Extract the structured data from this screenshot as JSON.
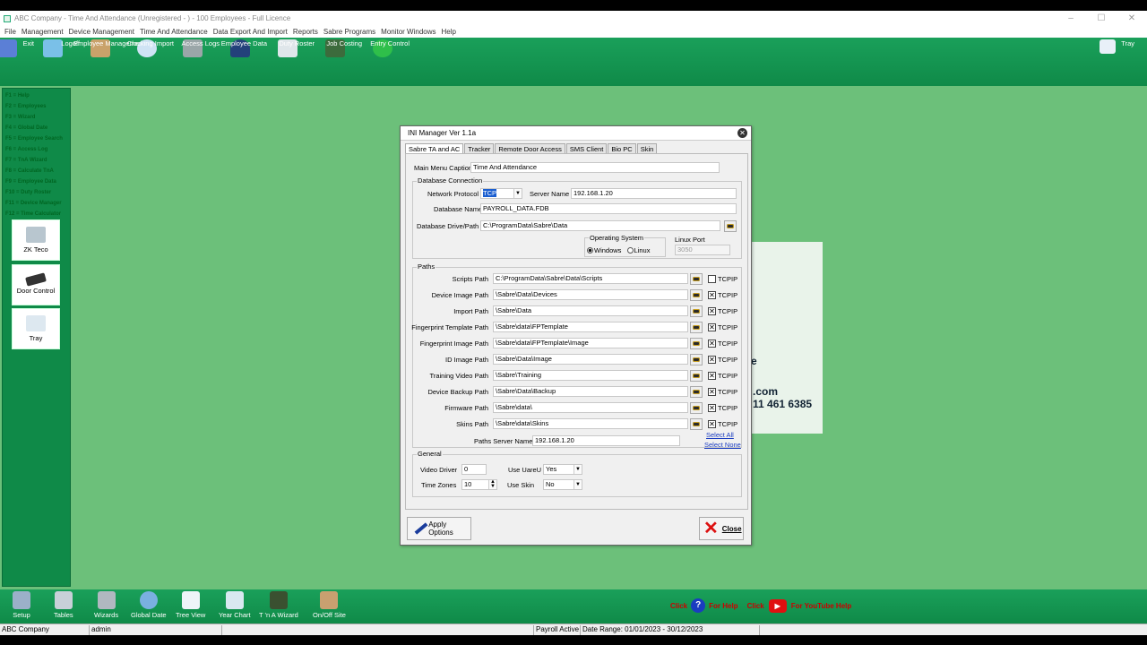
{
  "window": {
    "title": "ABC Company - Time And Attendance (Unregistered - ) - 100 Employees - Full Licence",
    "min": "–",
    "max": "☐",
    "close": "✕"
  },
  "menu": [
    "File",
    "Management",
    "Device Management",
    "Time And Attendance",
    "Data Export And Import",
    "Reports",
    "Sabre Programs",
    "Monitor Windows",
    "Help"
  ],
  "toolbar": [
    {
      "label": "Exit",
      "icon": "exit-icon"
    },
    {
      "label": "Logoff",
      "icon": "logoff-icon"
    },
    {
      "label": "Employee Management",
      "icon": "employees-icon"
    },
    {
      "label": "Clocking Import",
      "icon": "clock-icon"
    },
    {
      "label": "Access Logs",
      "icon": "access-logs-icon"
    },
    {
      "label": "Employee Data",
      "icon": "employee-icon"
    },
    {
      "label": "Duty Roster",
      "icon": "roster-icon"
    },
    {
      "label": "Job Costing",
      "icon": "job-costing-icon"
    },
    {
      "label": "Entry Control",
      "icon": "entry-control-icon"
    }
  ],
  "tray_button": "Tray",
  "function_keys": [
    "F1 = Help",
    "F2 = Employees",
    "F3 = Wizard",
    "F4 = Global Date",
    "F5 = Employee Search",
    "F6 = Access Log",
    "F7 = TnA Wizard",
    "F8 = Calculate TnA",
    "F9 = Employee Data",
    "F10 = Duty Roster",
    "F11 = Device Manager",
    "F12 = Time Calculator"
  ],
  "side_tiles": [
    {
      "label": "ZK Teco",
      "icon": "terminal-icon"
    },
    {
      "label": "Door Control",
      "icon": "door-icon"
    },
    {
      "label": "Tray",
      "icon": "tray-icon"
    }
  ],
  "background_text": {
    "line0": "e",
    "line1": ".com",
    "line2": "11 461 6385"
  },
  "dialog": {
    "title": "INI Manager Ver 1.1a",
    "tabs": [
      "Sabre TA and AC",
      "Tracker",
      "Remote Door Access",
      "SMS Client",
      "Bio PC",
      "Skin"
    ],
    "main_menu_caption_label": "Main Menu Caption",
    "main_menu_caption": "Time And Attendance",
    "db_group": "Database Connection",
    "network_protocol_label": "Network Protocol",
    "network_protocol": "TCP",
    "server_name_label": "Server Name",
    "server_name": "192.168.1.20",
    "database_name_label": "Database Name",
    "database_name": "PAYROLL_DATA.FDB",
    "database_path_label": "Database Drive/Path",
    "database_path": "C:\\ProgramData\\Sabre\\Data",
    "os_group": "Operating System",
    "os_windows": "Windows",
    "os_linux": "Linux",
    "linux_port_label": "Linux Port",
    "linux_port": "3050",
    "paths_group": "Paths",
    "tcpip": "TCPIP",
    "paths": [
      {
        "label": "Scripts Path",
        "value": "C:\\ProgramData\\Sabre\\Data\\Scripts",
        "tcpip": false
      },
      {
        "label": "Device Image Path",
        "value": "\\Sabre\\Data\\Devices",
        "tcpip": true
      },
      {
        "label": "Import Path",
        "value": "\\Sabre\\Data",
        "tcpip": true
      },
      {
        "label": "Fingerprint Template Path",
        "value": "\\Sabre\\data\\FPTemplate",
        "tcpip": true
      },
      {
        "label": "Fingerprint Image Path",
        "value": "\\Sabre\\data\\FPTemplate\\Image",
        "tcpip": true
      },
      {
        "label": "ID Image Path",
        "value": "\\Sabre\\Data\\Image",
        "tcpip": true
      },
      {
        "label": "Training Video Path",
        "value": "\\Sabre\\Training",
        "tcpip": true
      },
      {
        "label": "Device Backup Path",
        "value": "\\Sabre\\Data\\Backup",
        "tcpip": true
      },
      {
        "label": "Firmware Path",
        "value": "\\Sabre\\data\\",
        "tcpip": true
      },
      {
        "label": "Skins Path",
        "value": "\\Sabre\\data\\Skins",
        "tcpip": true
      }
    ],
    "paths_server_label": "Paths Server Name",
    "paths_server": "192.168.1.20",
    "select_all": "Select All",
    "select_none": "Select None",
    "general_group": "General",
    "video_driver_label": "Video Driver",
    "video_driver": "0",
    "use_uareu_label": "Use UareU",
    "use_uareu": "Yes",
    "time_zones_label": "Time Zones",
    "time_zones": "10",
    "use_skin_label": "Use Skin",
    "use_skin": "No",
    "apply_label": "Apply Options",
    "close_label": "Close"
  },
  "bottom_toolbar": [
    {
      "label": "Setup",
      "icon": "setup-icon"
    },
    {
      "label": "Tables",
      "icon": "tables-icon"
    },
    {
      "label": "Wizards",
      "icon": "wizard-icon"
    },
    {
      "label": "Global Date",
      "icon": "global-date-icon"
    },
    {
      "label": "Tree View",
      "icon": "tree-view-icon"
    },
    {
      "label": "Year Chart",
      "icon": "year-chart-icon"
    },
    {
      "label": "T 'n A Wizard",
      "icon": "tna-wizard-icon"
    },
    {
      "label": "On/Off Site",
      "icon": "onoff-site-icon"
    }
  ],
  "help": {
    "click1": "Click",
    "help": "For Help",
    "click2": "Click",
    "youtube": "For YouTube Help"
  },
  "status": {
    "company": "ABC Company",
    "user": "admin",
    "payroll": "Payroll Active",
    "range": "Date Range: 01/01/2023 - 30/12/2023"
  }
}
